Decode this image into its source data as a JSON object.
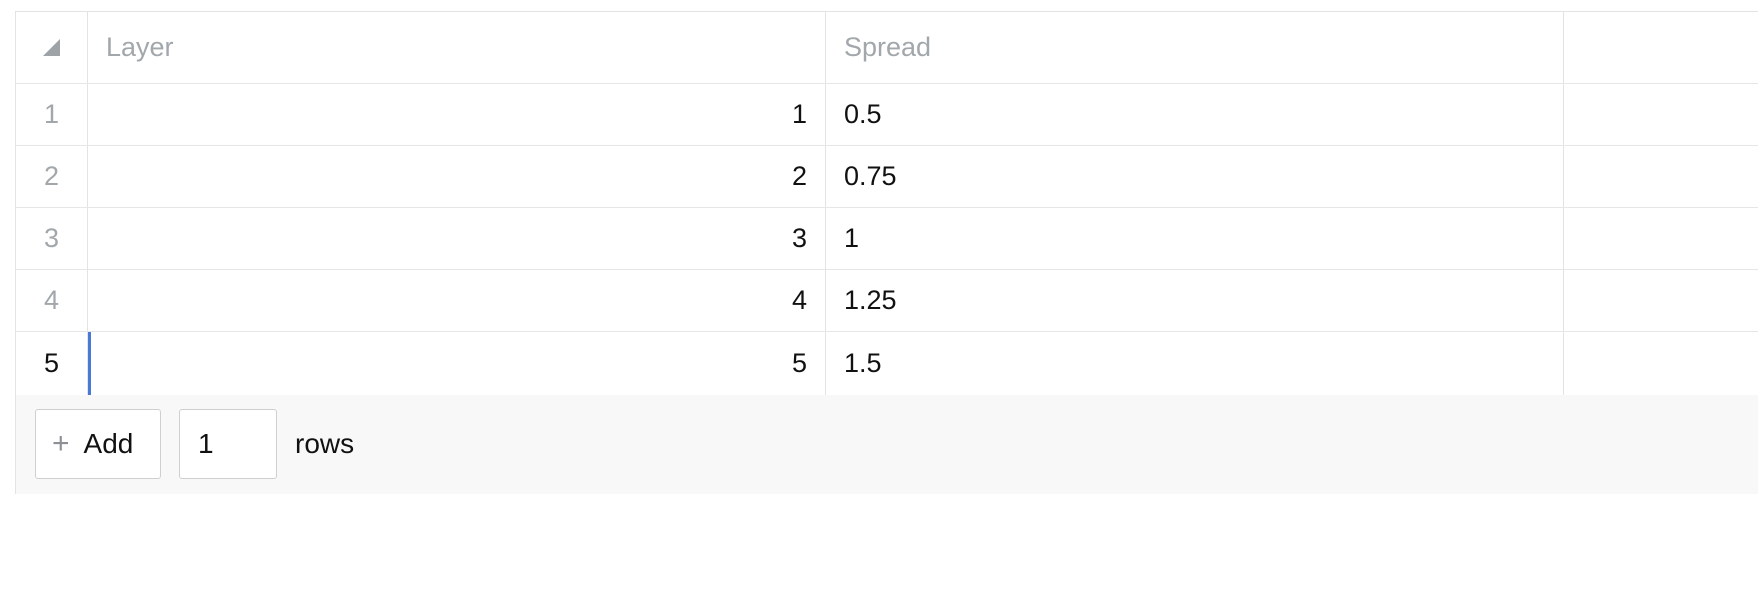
{
  "table": {
    "columns": [
      "Layer",
      "Spread"
    ],
    "rows": [
      {
        "index": "1",
        "layer": "1",
        "spread": "0.5"
      },
      {
        "index": "2",
        "layer": "2",
        "spread": "0.75"
      },
      {
        "index": "3",
        "layer": "3",
        "spread": "1"
      },
      {
        "index": "4",
        "layer": "4",
        "spread": "1.25"
      },
      {
        "index": "5",
        "layer": "5",
        "spread": "1.5"
      }
    ],
    "active_row": 5
  },
  "footer": {
    "add_label": "Add",
    "add_icon": "plus-icon",
    "row_count_value": "1",
    "rows_label": "rows"
  },
  "colors": {
    "active_indicator": "#4a78d6",
    "header_text": "#a2a7ab",
    "footer_bg": "#f8f8f8"
  }
}
